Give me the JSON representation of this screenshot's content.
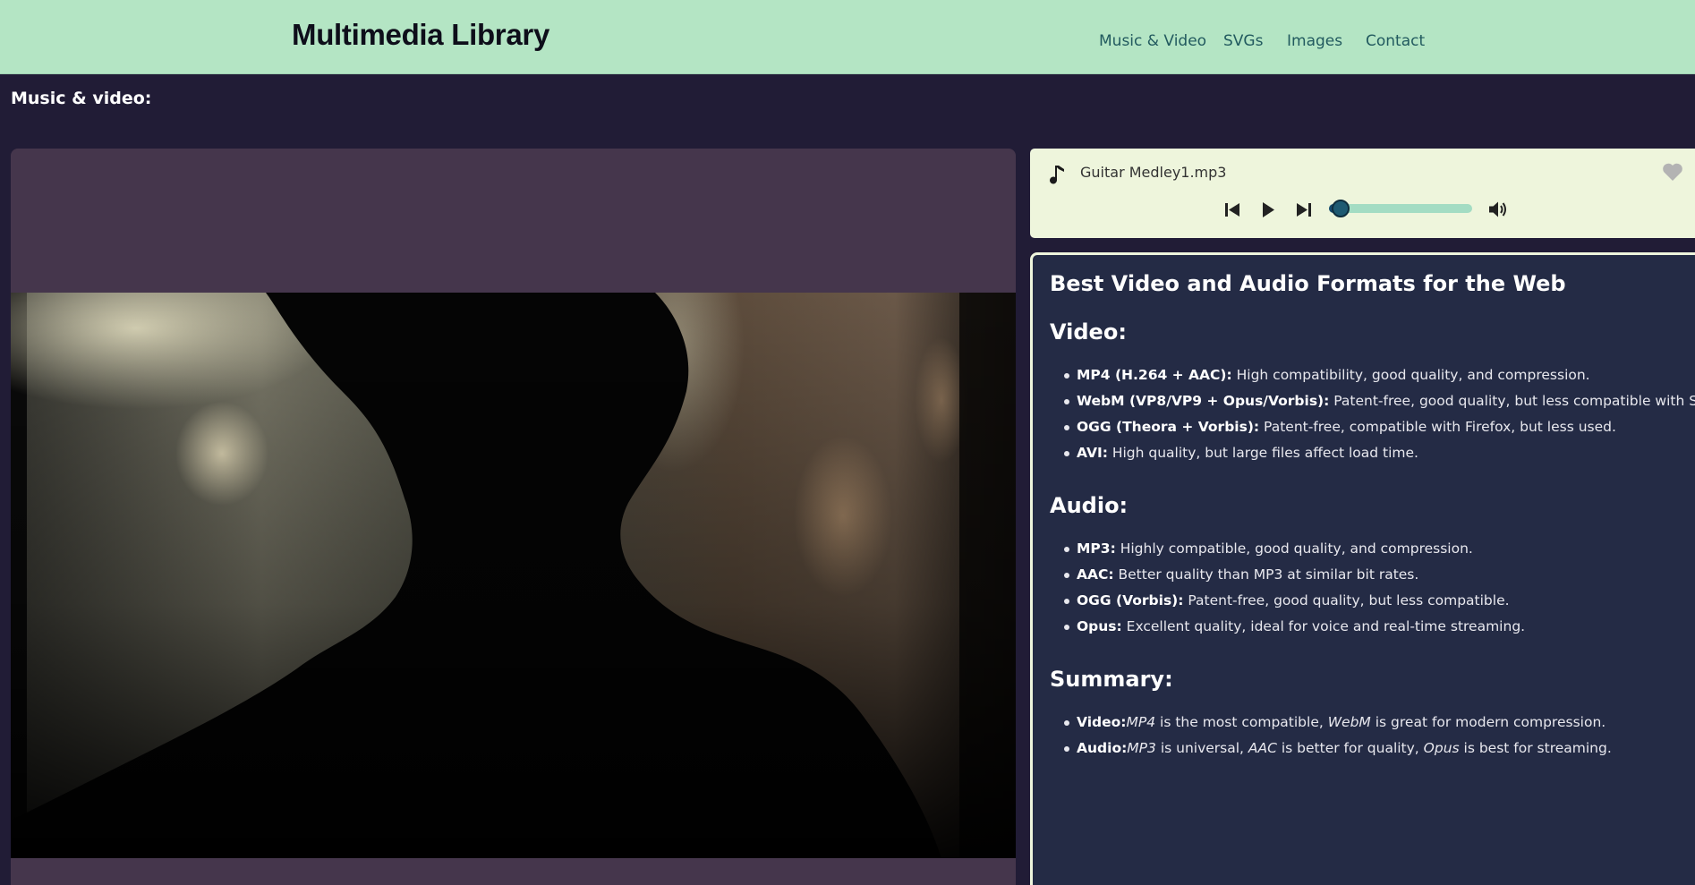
{
  "header": {
    "title": "Multimedia Library",
    "nav": [
      "Music & Video",
      "SVGs",
      "Images",
      "Contact"
    ]
  },
  "main": {
    "section_heading": "Music & video:"
  },
  "player": {
    "track_name": "Guitar Medley1.mp3",
    "progress_fraction": 0.08,
    "icons": [
      "music-note-icon",
      "heart-icon",
      "previous-icon",
      "play-icon",
      "next-icon",
      "volume-icon"
    ]
  },
  "info": {
    "title": "Best Video and Audio Formats for the Web",
    "video": {
      "heading": "Video:",
      "items": [
        {
          "label": "MP4 (H.264 + AAC):",
          "text": " High compatibility, good quality, and compression."
        },
        {
          "label": "WebM (VP8/VP9 + Opus/Vorbis):",
          "text": " Patent-free, good quality, but less compatible with Safari."
        },
        {
          "label": "OGG (Theora + Vorbis):",
          "text": " Patent-free, compatible with Firefox, but less used."
        },
        {
          "label": "AVI:",
          "text": " High quality, but large files affect load time."
        }
      ]
    },
    "audio": {
      "heading": "Audio:",
      "items": [
        {
          "label": "MP3:",
          "text": " Highly compatible, good quality, and compression."
        },
        {
          "label": "AAC:",
          "text": " Better quality than MP3 at similar bit rates."
        },
        {
          "label": "OGG (Vorbis):",
          "text": " Patent-free, good quality, but less compatible."
        },
        {
          "label": "Opus:",
          "text": " Excellent quality, ideal for voice and real-time streaming."
        }
      ]
    },
    "summary": {
      "heading": "Summary:",
      "video": {
        "label": "Video:",
        "f1": "MP4",
        "t1": " is the most compatible, ",
        "f2": "WebM",
        "t2": " is great for modern compression."
      },
      "audio": {
        "label": "Audio:",
        "f1": "MP3",
        "t1": " is universal, ",
        "f2": "AAC",
        "t2": " is better for quality, ",
        "f3": "Opus",
        "t3": " is best for streaming."
      }
    }
  },
  "colors": {
    "header_bg": "#b4e5c4",
    "page_bg": "#211c36",
    "nav_link": "#225a5f",
    "video_panel_bg": "#45364c",
    "player_bg": "#eef5dc",
    "info_bg": "#242b45"
  }
}
